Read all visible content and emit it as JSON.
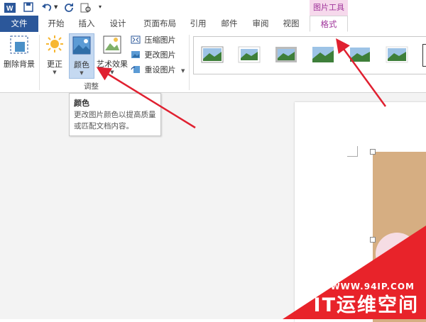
{
  "quick_access": {
    "icons": [
      "word-app-icon",
      "save-icon",
      "undo-icon",
      "redo-icon",
      "print-preview-icon",
      "customize-icon"
    ]
  },
  "tabs": {
    "file": "文件",
    "items": [
      "开始",
      "插入",
      "设计",
      "页面布局",
      "引用",
      "邮件",
      "审阅",
      "视图"
    ],
    "context_group": "图片工具",
    "active": "格式"
  },
  "ribbon": {
    "remove_background": "删除背景",
    "corrections": "更正",
    "color": "颜色",
    "artistic_effects": "艺术效果",
    "compress": "压缩图片",
    "change": "更改图片",
    "reset": "重设图片",
    "group_label": "调整"
  },
  "tooltip": {
    "title": "颜色",
    "description": "更改图片颜色以提高质量或匹配文档内容。"
  },
  "watermark": {
    "url": "WWW.94IP.COM",
    "text": "IT运维空间"
  },
  "colors": {
    "accent": "#2b579a",
    "context_tab": "#a0359b",
    "arrow": "#e02030",
    "watermark_bg": "#e8232a"
  }
}
